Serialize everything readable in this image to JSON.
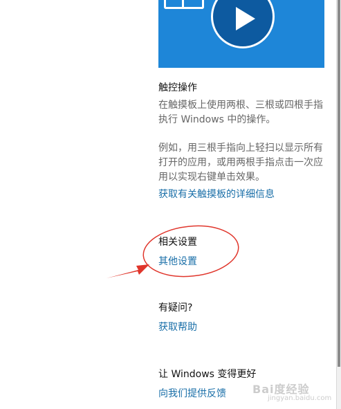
{
  "touch_section": {
    "title": "触控操作",
    "desc1": "在触摸板上使用两根、三根或四根手指执行 Windows 中的操作。",
    "desc2": "例如，用三根手指向上轻扫以显示所有打开的应用，或用两根手指点击一次应用以实现右键单击效果。",
    "link": "获取有关触摸板的详细信息"
  },
  "related_section": {
    "title": "相关设置",
    "link": "其他设置"
  },
  "help_section": {
    "title": "有疑问?",
    "link": "获取帮助"
  },
  "feedback_section": {
    "title": "让 Windows 变得更好",
    "link": "向我们提供反馈"
  },
  "watermark": {
    "brand": "Bai度经验",
    "url": "jingyan.baidu.com"
  },
  "colors": {
    "accent_link": "#1a6fa8",
    "tile_blue": "#1e86d8",
    "annotation_red": "#e0352b"
  },
  "icons": {
    "video_tile": "play-icon"
  }
}
